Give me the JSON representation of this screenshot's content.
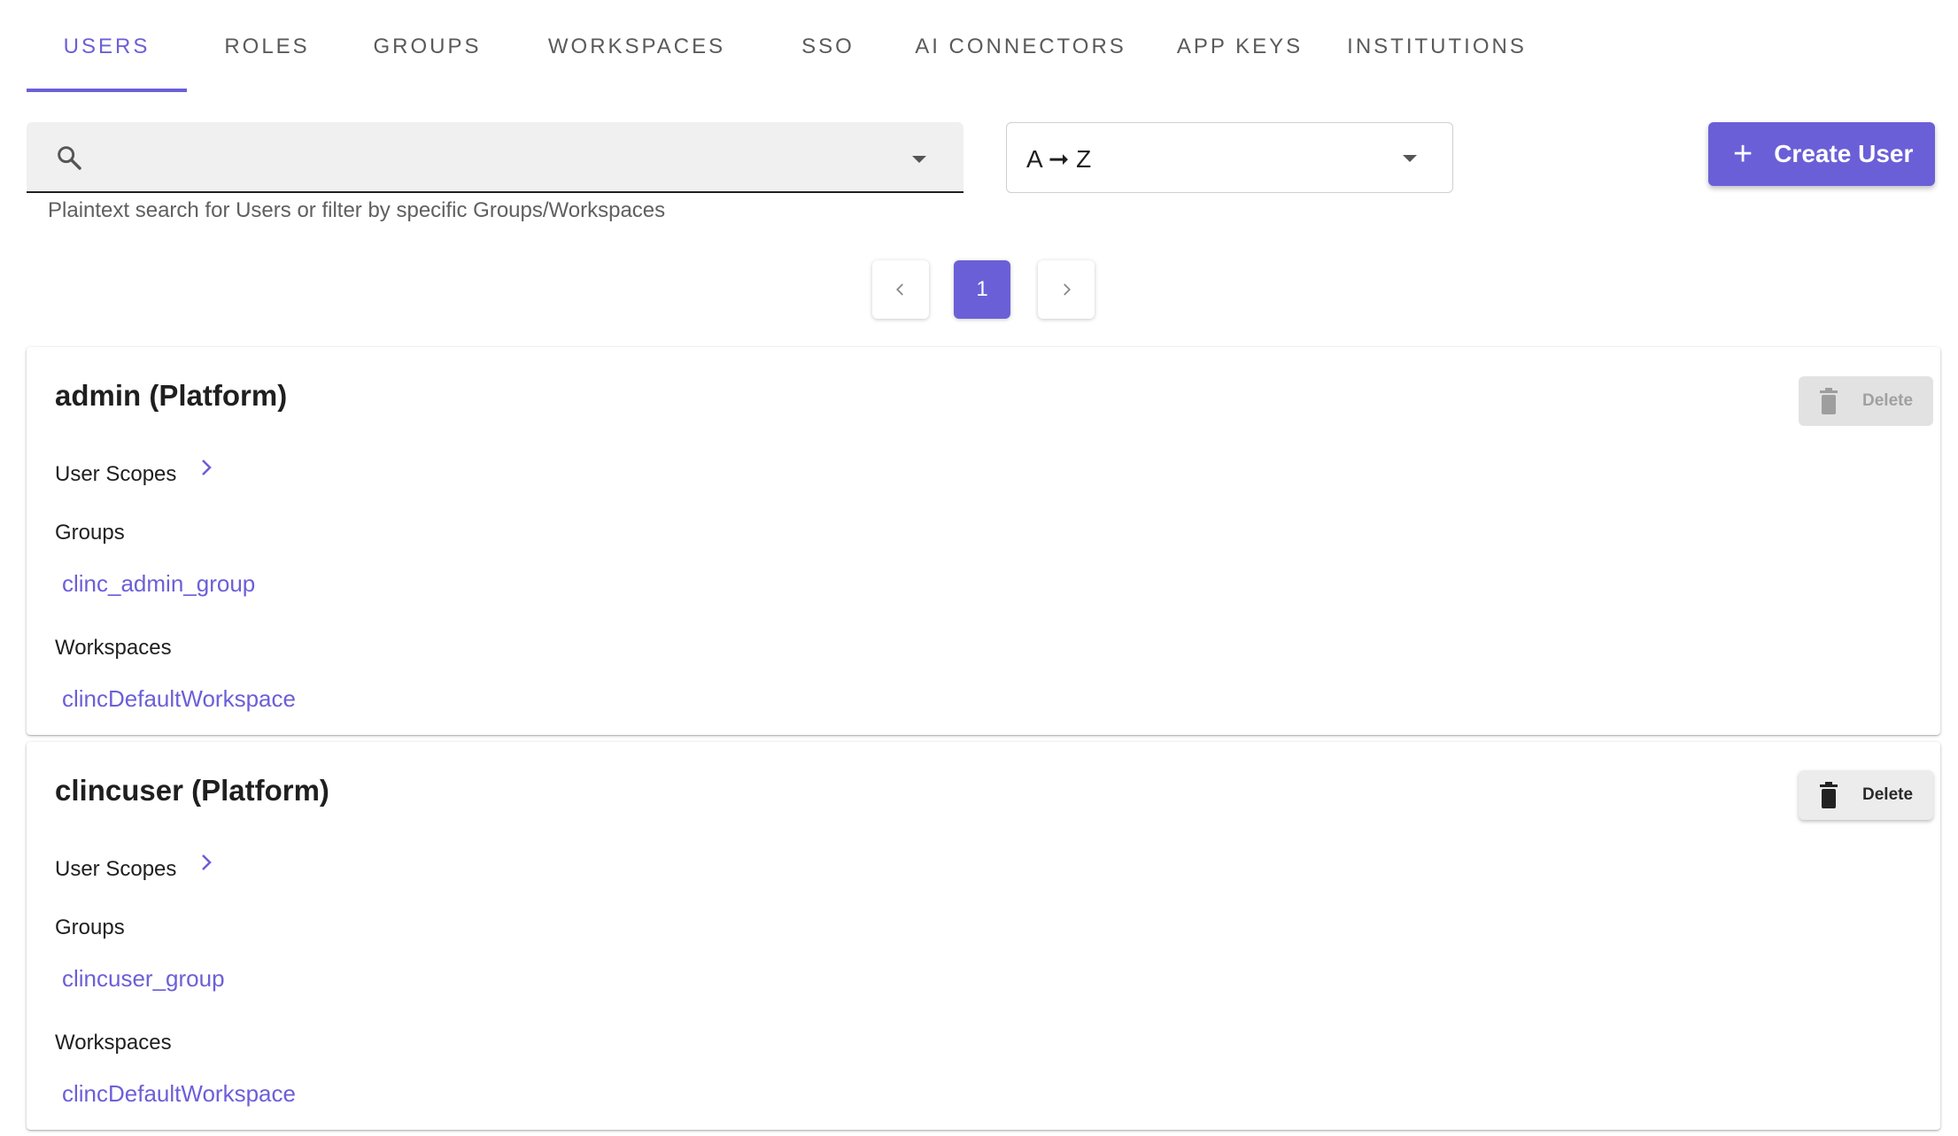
{
  "tabs": [
    {
      "label": "USERS",
      "active": true
    },
    {
      "label": "ROLES"
    },
    {
      "label": "GROUPS"
    },
    {
      "label": "WORKSPACES"
    },
    {
      "label": "SSO"
    },
    {
      "label": "AI CONNECTORS"
    },
    {
      "label": "APP KEYS"
    },
    {
      "label": "INSTITUTIONS"
    }
  ],
  "search": {
    "value": "",
    "helper": "Plaintext search for Users or filter by specific Groups/Workspaces"
  },
  "sort": {
    "value": "A ➞ Z"
  },
  "create_button": {
    "label": "Create User"
  },
  "pagination": {
    "prev": "‹",
    "current": "1",
    "next": "›"
  },
  "users": [
    {
      "title": "admin (Platform)",
      "delete_label": "Delete",
      "delete_disabled": true,
      "scopes_label": "User Scopes",
      "groups_label": "Groups",
      "group": "clinc_admin_group",
      "workspaces_label": "Workspaces",
      "workspace": "clincDefaultWorkspace"
    },
    {
      "title": "clincuser (Platform)",
      "delete_label": "Delete",
      "delete_disabled": false,
      "scopes_label": "User Scopes",
      "groups_label": "Groups",
      "group": "clincuser_group",
      "workspaces_label": "Workspaces",
      "workspace": "clincDefaultWorkspace"
    }
  ],
  "colors": {
    "accent": "#6b5fd8"
  }
}
